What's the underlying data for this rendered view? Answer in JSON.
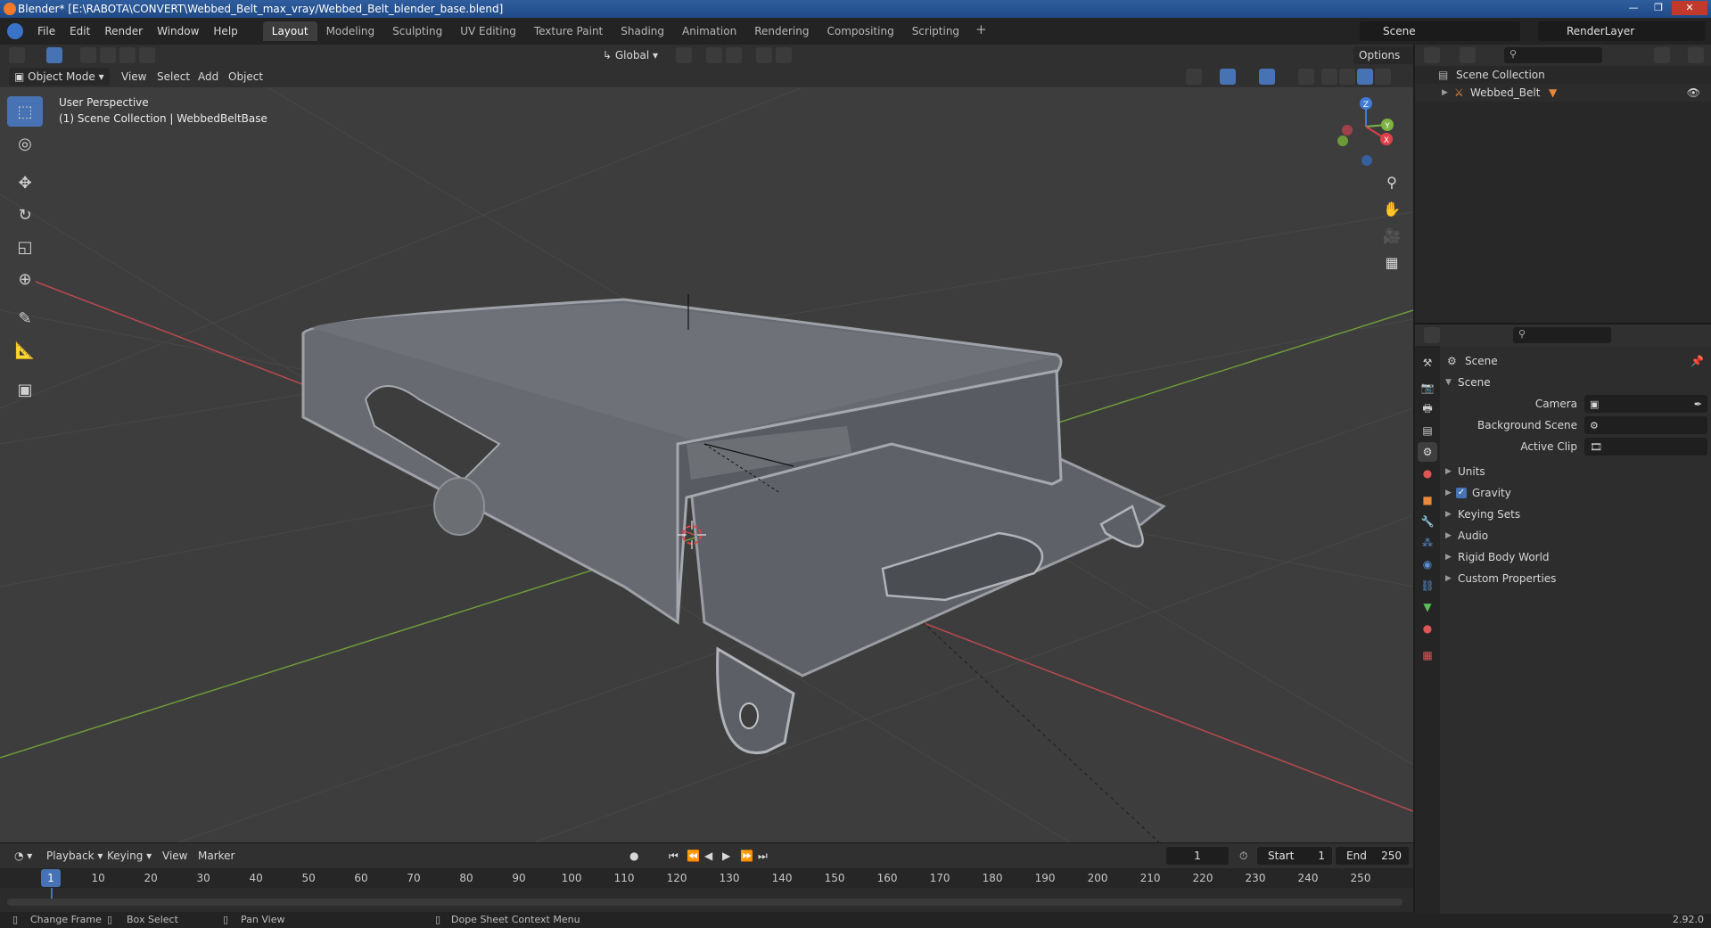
{
  "window": {
    "title": "Blender* [E:\\RABOTA\\CONVERT\\Webbed_Belt_max_vray/Webbed_Belt_blender_base.blend]"
  },
  "menu": {
    "items": [
      "File",
      "Edit",
      "Render",
      "Window",
      "Help"
    ],
    "workspaces": [
      "Layout",
      "Modeling",
      "Sculpting",
      "UV Editing",
      "Texture Paint",
      "Shading",
      "Animation",
      "Rendering",
      "Compositing",
      "Scripting"
    ],
    "active_workspace": "Layout",
    "add_workspace": "+",
    "scene": "Scene",
    "render_layer": "RenderLayer"
  },
  "viewport_header": {
    "orientation": "Global",
    "options": "Options",
    "mode": "Object Mode",
    "menus": [
      "View",
      "Select",
      "Add",
      "Object"
    ]
  },
  "viewport": {
    "perspective": "User Perspective",
    "collection_info": "(1) Scene Collection | WebbedBeltBase",
    "gizmo_axes": {
      "x": "X",
      "y": "Y",
      "z": "Z"
    }
  },
  "toolbar": {
    "tools": [
      "select-box",
      "cursor",
      "move",
      "rotate",
      "scale",
      "transform",
      "annotate",
      "measure",
      "add-cube"
    ],
    "active": "select-box"
  },
  "outliner": {
    "root": "Scene Collection",
    "items": [
      "Webbed_Belt"
    ]
  },
  "properties": {
    "panel_title": "Scene",
    "section": "Scene",
    "fields": [
      {
        "label": "Camera",
        "value": ""
      },
      {
        "label": "Background Scene",
        "value": ""
      },
      {
        "label": "Active Clip",
        "value": ""
      }
    ],
    "subpanels": [
      "Units",
      "Gravity",
      "Keying Sets",
      "Audio",
      "Rigid Body World",
      "Custom Properties"
    ],
    "gravity_checked": true
  },
  "timeline": {
    "menus": [
      "Playback",
      "Keying",
      "View",
      "Marker"
    ],
    "current_frame": "1",
    "start_label": "Start",
    "start": "1",
    "end_label": "End",
    "end": "250",
    "ticks": [
      "1",
      "10",
      "20",
      "30",
      "40",
      "50",
      "60",
      "70",
      "80",
      "90",
      "100",
      "110",
      "120",
      "130",
      "140",
      "150",
      "160",
      "170",
      "180",
      "190",
      "200",
      "210",
      "220",
      "230",
      "240",
      "250"
    ]
  },
  "statusbar": {
    "items": [
      "Change Frame",
      "Box Select",
      "Pan View",
      "Dope Sheet Context Menu"
    ],
    "version": "2.92.0"
  },
  "colors": {
    "accent": "#4772b3",
    "axis_x": "#e0404a",
    "axis_y": "#7cb342",
    "axis_z": "#3f7ad6"
  }
}
